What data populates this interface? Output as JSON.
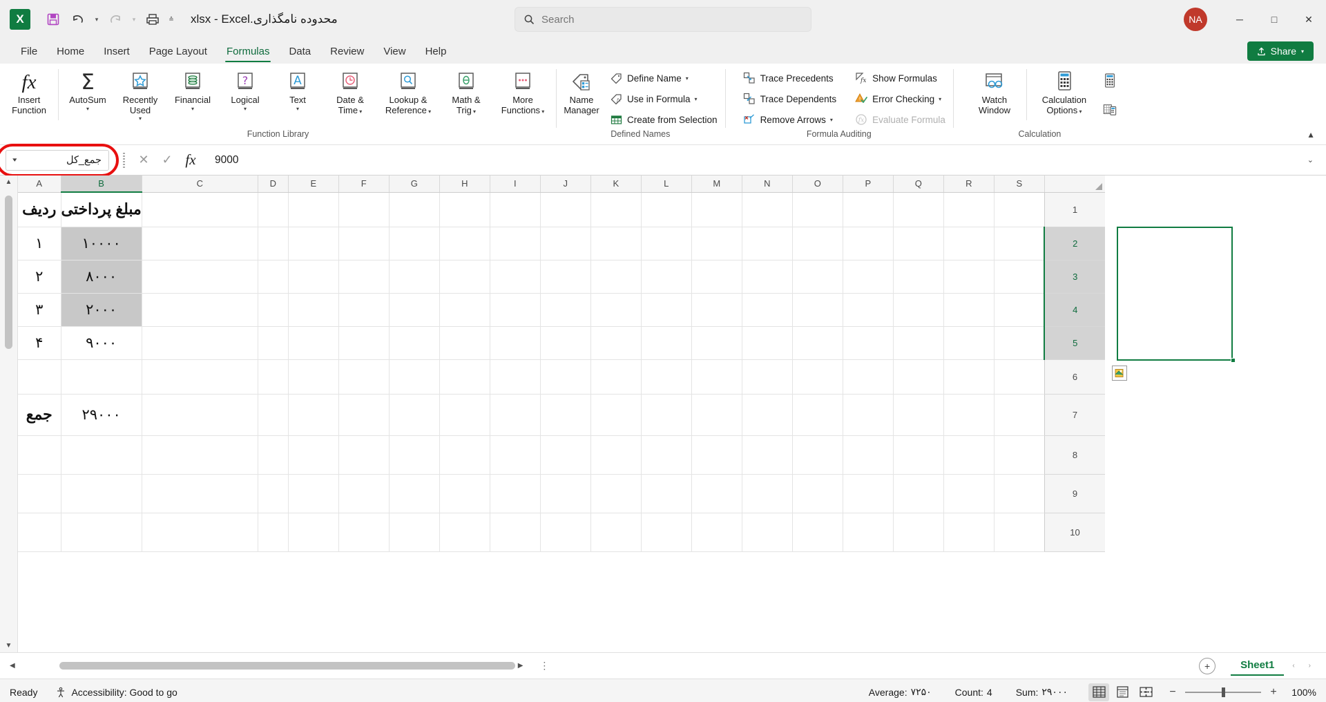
{
  "titlebar": {
    "app_logo": "excel-logo",
    "document_title": "محدوده نامگذاری.xlsx - Excel",
    "qat": [
      {
        "name": "save",
        "icon": "save-icon"
      },
      {
        "name": "undo",
        "icon": "undo-icon"
      },
      {
        "name": "redo",
        "icon": "redo-icon"
      },
      {
        "name": "print",
        "icon": "print-icon"
      },
      {
        "name": "customize",
        "icon": "overflow-icon"
      }
    ],
    "search_placeholder": "Search",
    "search_value": "",
    "avatar_initials": "NA",
    "minimize": "─",
    "maximize": "□",
    "close": "✕"
  },
  "tabs": [
    {
      "label": "File",
      "active": false
    },
    {
      "label": "Home",
      "active": false
    },
    {
      "label": "Insert",
      "active": false
    },
    {
      "label": "Page Layout",
      "active": false
    },
    {
      "label": "Formulas",
      "active": true
    },
    {
      "label": "Data",
      "active": false
    },
    {
      "label": "Review",
      "active": false
    },
    {
      "label": "View",
      "active": false
    },
    {
      "label": "Help",
      "active": false
    }
  ],
  "share_label": "Share",
  "ribbon": {
    "function_library": {
      "group_label": "Function Library",
      "insert_function": "Insert\nFunction",
      "items": [
        {
          "l1": "Insert",
          "l2": "Function",
          "caret": false
        },
        {
          "l1": "AutoSum",
          "l2": "",
          "caret": true
        },
        {
          "l1": "Recently",
          "l2": "Used",
          "caret": true
        },
        {
          "l1": "Financial",
          "l2": "",
          "caret": true
        },
        {
          "l1": "Logical",
          "l2": "",
          "caret": true
        },
        {
          "l1": "Text",
          "l2": "",
          "caret": true
        },
        {
          "l1": "Date &",
          "l2": "Time",
          "caret": true
        },
        {
          "l1": "Lookup &",
          "l2": "Reference",
          "caret": true
        },
        {
          "l1": "Math &",
          "l2": "Trig",
          "caret": true
        },
        {
          "l1": "More",
          "l2": "Functions",
          "caret": true
        }
      ]
    },
    "defined_names": {
      "group_label": "Defined Names",
      "name_manager_l1": "Name",
      "name_manager_l2": "Manager",
      "items": [
        {
          "label": "Define Name",
          "caret": true,
          "disabled": false
        },
        {
          "label": "Use in Formula",
          "caret": true,
          "disabled": false
        },
        {
          "label": "Create from Selection",
          "caret": false,
          "disabled": false
        }
      ]
    },
    "formula_auditing": {
      "group_label": "Formula Auditing",
      "left_items": [
        {
          "label": "Trace Precedents",
          "caret": false,
          "disabled": false
        },
        {
          "label": "Trace Dependents",
          "caret": false,
          "disabled": false
        },
        {
          "label": "Remove Arrows",
          "caret": true,
          "disabled": false
        }
      ],
      "right_items": [
        {
          "label": "Show Formulas",
          "caret": false,
          "disabled": false
        },
        {
          "label": "Error Checking",
          "caret": true,
          "disabled": false
        },
        {
          "label": "Evaluate Formula",
          "caret": false,
          "disabled": true
        }
      ]
    },
    "calculation": {
      "group_label": "Calculation",
      "watch_l1": "Watch",
      "watch_l2": "Window",
      "calc_l1": "Calculation",
      "calc_l2": "Options",
      "calc_now": "calculate-now-icon",
      "calc_sheet": "calculate-sheet-icon"
    },
    "collapse_icon": "chevron-up-icon"
  },
  "formula_bar": {
    "name_box_value": "جمع_کل",
    "name_box_highlighted": true,
    "highlight_color": "#e81010",
    "cancel_icon": "✕",
    "enter_icon": "✓",
    "fx_icon": "fx",
    "formula_value": "9000",
    "expand_icon": "⌄"
  },
  "grid": {
    "columns": [
      "S",
      "R",
      "Q",
      "P",
      "O",
      "N",
      "M",
      "L",
      "K",
      "J",
      "I",
      "H",
      "G",
      "F",
      "E",
      "D",
      "C",
      "B",
      "A"
    ],
    "selected_column": "B",
    "rows": [
      "1",
      "2",
      "3",
      "4",
      "5",
      "6",
      "7",
      "8",
      "9",
      "10"
    ],
    "selected_rows": [
      "2",
      "3",
      "4",
      "5"
    ],
    "cells": {
      "A1": "ردیف",
      "B1": "مبلغ پرداختی",
      "A2": "۱",
      "B2": "۱۰۰۰۰",
      "A3": "۲",
      "B3": "۸۰۰۰",
      "A4": "۳",
      "B4": "۲۰۰۰",
      "A5": "۴",
      "B5": "۹۰۰۰",
      "A7": "جمع",
      "B7": "۲۹۰۰۰"
    },
    "shaded_cells": [
      "B2",
      "B3",
      "B4"
    ],
    "selection_range": "B2:B5",
    "active_cell": "B5",
    "smart_tag": "paste-options-icon"
  },
  "sheet_tabs": {
    "add_sheet_label": "+",
    "tabs": [
      {
        "label": "Sheet1",
        "active": true
      }
    ],
    "prev_arrow": "‹",
    "next_arrow": "›"
  },
  "status_bar": {
    "state": "Ready",
    "accessibility": "Accessibility: Good to go",
    "average_label": "Average:",
    "average_value": "۷۲۵۰",
    "count_label": "Count:",
    "count_value": "4",
    "sum_label": "Sum:",
    "sum_value": "۲۹۰۰۰",
    "views": [
      {
        "name": "normal-view",
        "active": true
      },
      {
        "name": "page-layout-view",
        "active": false
      },
      {
        "name": "page-break-view",
        "active": false
      }
    ],
    "zoom_out": "−",
    "zoom_in": "+",
    "zoom_level": "100%"
  },
  "colors": {
    "brand_green": "#107c41",
    "highlight_red": "#e81010",
    "selection_green": "#107c41",
    "shade_gray": "#c8c8c8"
  }
}
